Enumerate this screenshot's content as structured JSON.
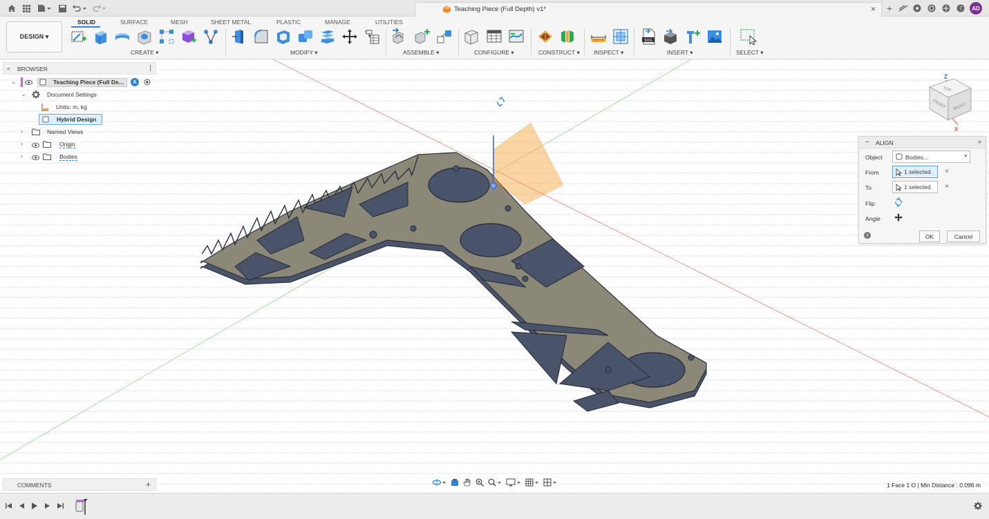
{
  "titlebar": {
    "document_title": "Teaching Piece (Full Depth) v1*",
    "close_glyph": "×",
    "user_initials": "AD"
  },
  "toolbar": {
    "workspace_label": "DESIGN ▾",
    "tabs": [
      "SOLID",
      "SURFACE",
      "MESH",
      "SHEET METAL",
      "PLASTIC",
      "MANAGE",
      "UTILITIES"
    ],
    "groups": [
      "CREATE ▾",
      "MODIFY ▾",
      "ASSEMBLE ▾",
      "CONFIGURE ▾",
      "CONSTRUCT ▾",
      "INSPECT ▾",
      "INSERT ▾",
      "SELECT ▾"
    ]
  },
  "browser": {
    "title": "BROWSER",
    "root": "Teaching Piece (Full De...",
    "items": [
      "Document Settings",
      "Units: m, kg",
      "Hybrid Design",
      "Named Views",
      "Origin",
      "Bodies"
    ]
  },
  "align": {
    "title": "ALIGN",
    "object_label": "Object",
    "object_value": "Bodies...",
    "from_label": "From",
    "from_value": "1 selected",
    "to_label": "To",
    "to_value": "1 selected",
    "flip_label": "Flip",
    "angle_label": "Angle",
    "ok": "OK",
    "cancel": "Cancel"
  },
  "viewcube": {
    "top": "TOP",
    "front": "FRONT",
    "right": "RIGHT",
    "z_axis": "Z",
    "x_axis": "X"
  },
  "comments": {
    "label": "COMMENTS",
    "add": "+"
  },
  "status": {
    "text": "1 Face 1 O | Min Distance : 0.096 m"
  },
  "colors": {
    "accent": "#2f84d6",
    "part_body": "#4a5468",
    "part_top": "#8c8878",
    "grid": "#dcdcdc",
    "x_axis": "#e05555",
    "y_axis": "#6cc26c",
    "plane": "#f4a53a",
    "avatar": "#7b2f8f"
  }
}
